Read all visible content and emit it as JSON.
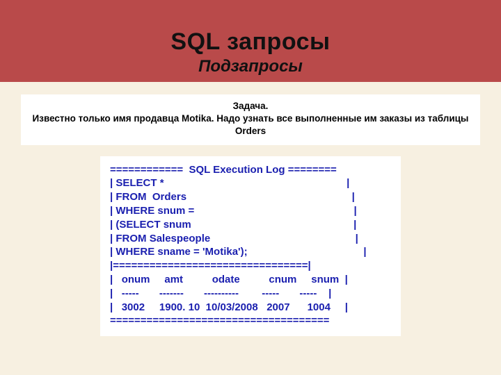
{
  "header": {
    "title": "SQL запросы",
    "subtitle": "Подзапросы"
  },
  "task": {
    "label": "Задача.",
    "text": "Известно только имя продавца Motika. Надо узнать все выполненные им заказы из таблицы Orders"
  },
  "code": {
    "lines": [
      "============  SQL Execution Log ========",
      "| SELECT *                                                               |",
      "| FROM  Orders                                                         |",
      "| WHERE snum =                                                       |",
      "| (SELECT snum                                                        |",
      "| FROM Salespeople                                                  |",
      "| WHERE sname = 'Motika');                                        |",
      "|================================|",
      "|   onum     amt          odate          cnum     snum  |",
      "|   -----       -------       ----------        -----       -----    |",
      "|   3002     1900. 10  10/03/2008   2007      1004     |",
      "===================================="
    ]
  },
  "chart_data": {
    "type": "table",
    "title": "SQL Execution Log",
    "sql": "SELECT * FROM Orders WHERE snum = (SELECT snum FROM Salespeople WHERE sname = 'Motika');",
    "columns": [
      "onum",
      "amt",
      "odate",
      "cnum",
      "snum"
    ],
    "rows": [
      {
        "onum": 3002,
        "amt": 1900.1,
        "odate": "10/03/2008",
        "cnum": 2007,
        "snum": 1004
      }
    ]
  }
}
